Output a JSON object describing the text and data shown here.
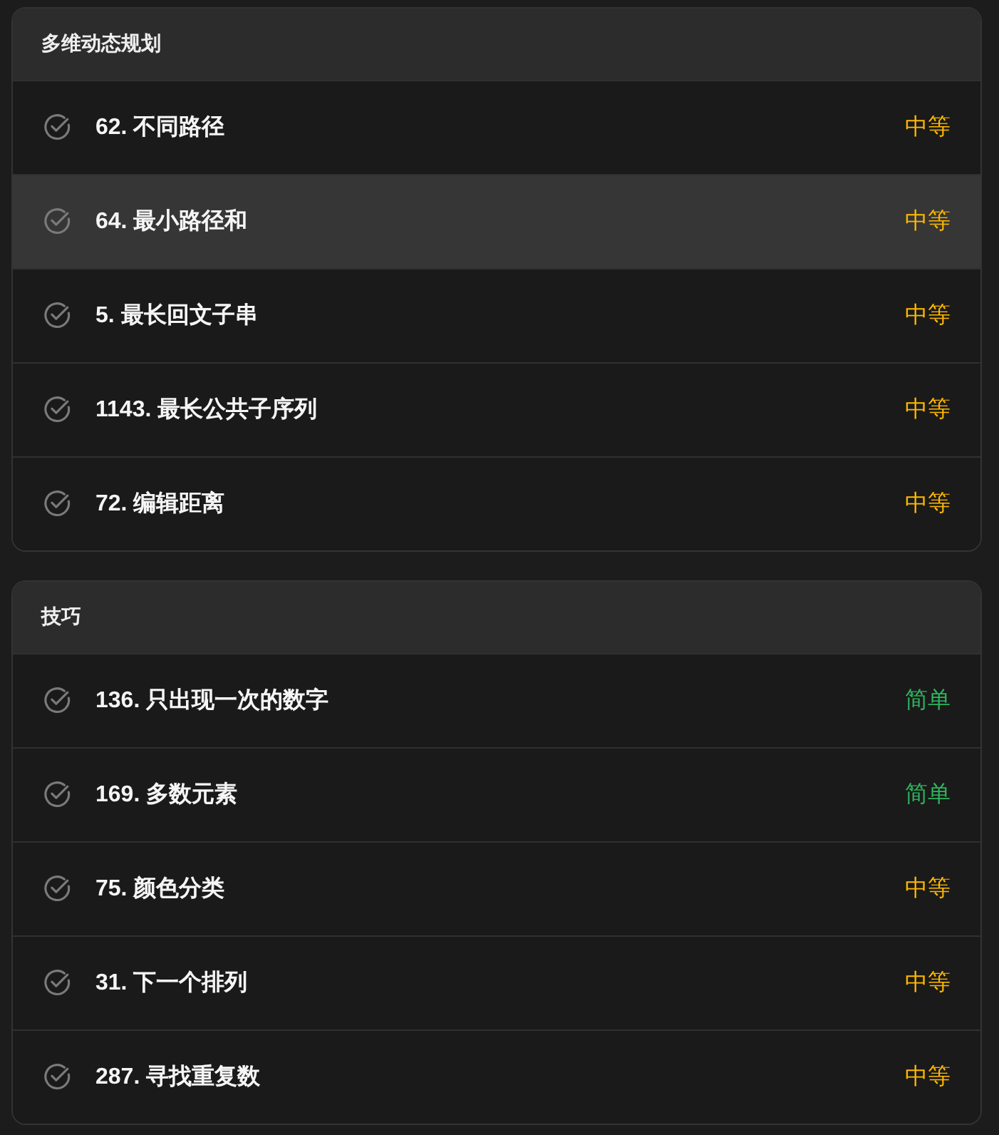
{
  "sections": [
    {
      "title": "多维动态规划",
      "problems": [
        {
          "title": "62. 不同路径",
          "difficulty": "中等",
          "color": "#ffb800",
          "highlighted": false
        },
        {
          "title": "64. 最小路径和",
          "difficulty": "中等",
          "color": "#ffb800",
          "highlighted": true
        },
        {
          "title": "5. 最长回文子串",
          "difficulty": "中等",
          "color": "#ffb800",
          "highlighted": false
        },
        {
          "title": "1143. 最长公共子序列",
          "difficulty": "中等",
          "color": "#ffb800",
          "highlighted": false
        },
        {
          "title": "72. 编辑距离",
          "difficulty": "中等",
          "color": "#ffb800",
          "highlighted": false
        }
      ]
    },
    {
      "title": "技巧",
      "problems": [
        {
          "title": "136. 只出现一次的数字",
          "difficulty": "简单",
          "color": "#2db55d",
          "highlighted": false
        },
        {
          "title": "169. 多数元素",
          "difficulty": "简单",
          "color": "#2db55d",
          "highlighted": false
        },
        {
          "title": "75. 颜色分类",
          "difficulty": "中等",
          "color": "#ffb800",
          "highlighted": false
        },
        {
          "title": "31. 下一个排列",
          "difficulty": "中等",
          "color": "#ffb800",
          "highlighted": false
        },
        {
          "title": "287. 寻找重复数",
          "difficulty": "中等",
          "color": "#ffb800",
          "highlighted": false
        }
      ]
    }
  ]
}
